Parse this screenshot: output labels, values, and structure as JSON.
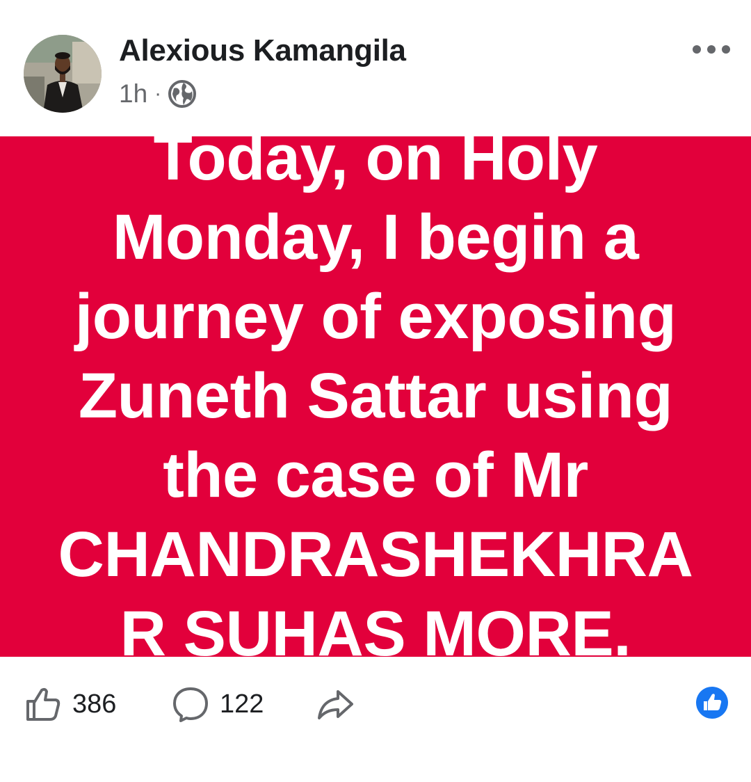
{
  "post": {
    "author": "Alexious Kamangila",
    "time": "1h",
    "separator": "·",
    "privacy_icon": "globe-icon",
    "menu_icon": "more-dots-icon"
  },
  "banner": {
    "background_color": "#e2003b",
    "text_color": "#ffffff",
    "lines": [
      "Today, on Holy",
      "Monday, I begin a",
      "journey of exposing",
      "Zuneth Sattar using",
      "the case of Mr",
      "CHANDRASHEKHRA",
      "R SUHAS MORE."
    ]
  },
  "actions": {
    "like_count": "386",
    "comment_count": "122",
    "like_icon": "thumbs-up-icon",
    "comment_icon": "comment-bubble-icon",
    "share_icon": "share-arrow-icon",
    "reaction_icon": "like-reaction-icon",
    "reaction_color": "#1877f2"
  }
}
